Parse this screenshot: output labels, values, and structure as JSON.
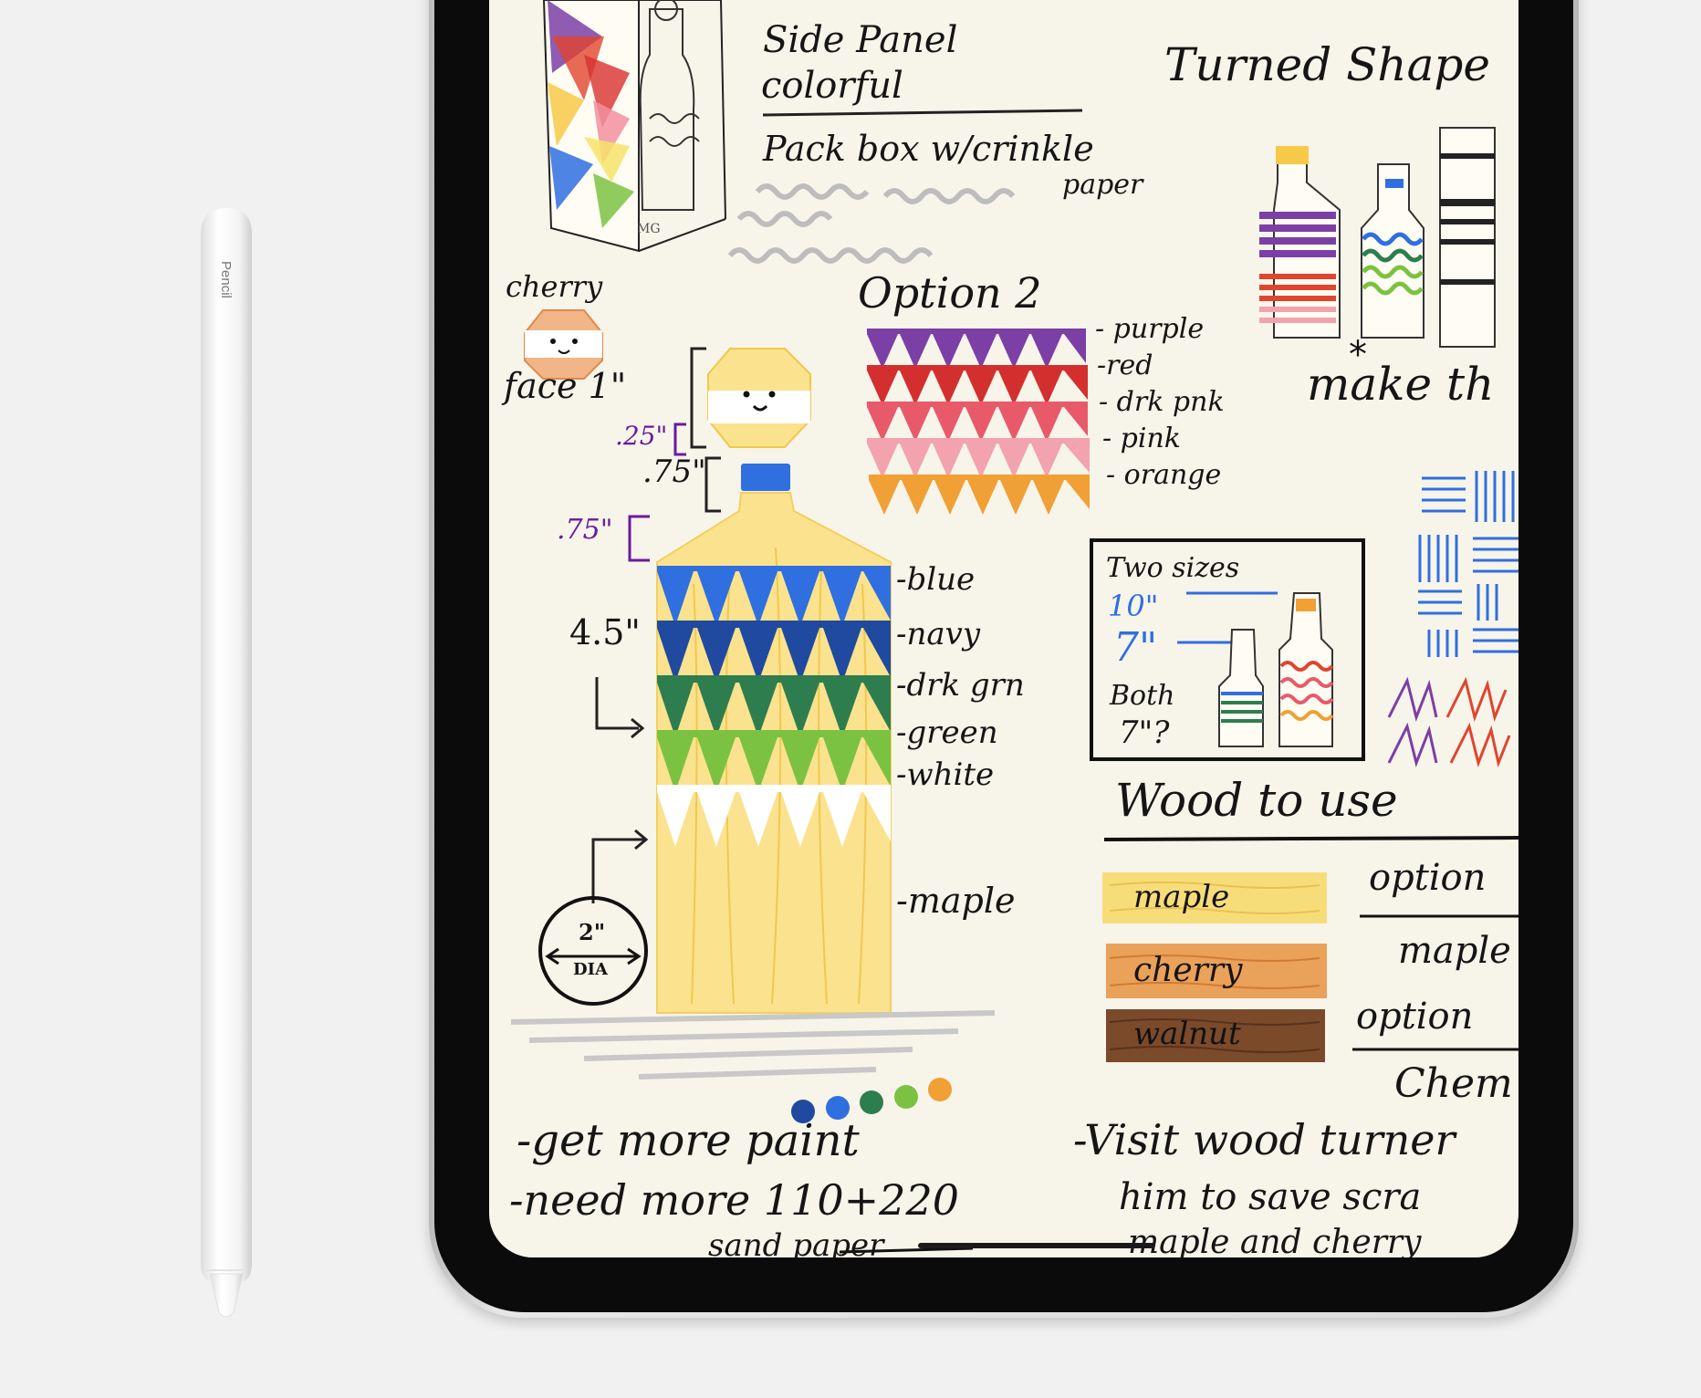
{
  "pencil": {
    "brand_text": "Pencil"
  },
  "note": {
    "top": {
      "side_panel_title": "Side Panel",
      "side_panel_sub": "colorful",
      "pack_box": "Pack box w/crinkle",
      "paper": "paper",
      "turned_shapes": "Turned Shape",
      "monogram": "MG"
    },
    "cherry_label": "cherry",
    "face_label": "face 1\"",
    "dims": {
      "d1": ".25\"",
      "d2": ".75\"",
      "d3": ".75\"",
      "height": "4.5\"",
      "dia_top": "2\"",
      "dia_bottom": "DIA"
    },
    "bottle_stripes": [
      "-blue",
      "-navy",
      "-drk grn",
      "-green",
      "-white",
      "-maple"
    ],
    "option2": {
      "title": "Option 2",
      "stripes": [
        "- purple",
        "-red",
        "- drk pnk",
        "- pink",
        "- orange"
      ]
    },
    "make_the": "make th",
    "two_sizes": {
      "title": "Two sizes",
      "size_a": "10\"",
      "size_b": "7\"",
      "both": "Both",
      "both_q": "7\"?"
    },
    "wood": {
      "title": "Wood to use",
      "swatches": [
        {
          "label": "maple",
          "color": "#f7dd7a"
        },
        {
          "label": "cherry",
          "color": "#eaa15a"
        },
        {
          "label": "walnut",
          "color": "#7a4a2a"
        }
      ],
      "options": [
        "option",
        "maple",
        "option",
        "Chem"
      ]
    },
    "todo": {
      "item1": "-get more paint",
      "item2": "-need more 110+220",
      "item2_sub": "sand paper",
      "item3": "-Visit wood turner",
      "item3_sub1": "him to save scra",
      "item3_sub2": "maple and cherry"
    },
    "paint_dots": [
      "#1f4aa0",
      "#2f6fe0",
      "#2e7d4f",
      "#7cc242",
      "#f0a035"
    ]
  }
}
